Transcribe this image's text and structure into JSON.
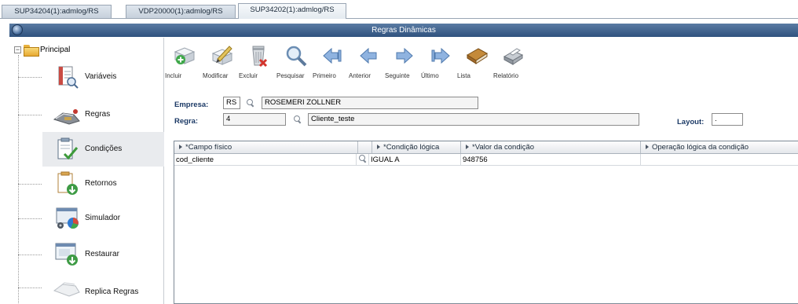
{
  "tabs": [
    {
      "label": "SUP34204(1):admlog/RS",
      "active": false
    },
    {
      "label": "VDP20000(1):admlog/RS",
      "active": false
    },
    {
      "label": "SUP34202(1):admlog/RS",
      "active": true
    }
  ],
  "window": {
    "title": "Regras Dinâmicas",
    "icon": "app-globe-icon"
  },
  "sidebar": {
    "root_label": "Principal",
    "items": [
      {
        "label": "Variáveis",
        "icon": "variables-icon"
      },
      {
        "label": "Regras",
        "icon": "rules-icon"
      },
      {
        "label": "Condições",
        "icon": "conditions-icon"
      },
      {
        "label": "Retornos",
        "icon": "returns-icon"
      },
      {
        "label": "Simulador",
        "icon": "simulator-icon"
      },
      {
        "label": "Restaurar",
        "icon": "restore-icon"
      },
      {
        "label": "Replica Regras",
        "icon": "replicate-icon"
      }
    ]
  },
  "toolbar": {
    "buttons": [
      {
        "label": "Incluir",
        "icon": "include-icon"
      },
      {
        "label": "Modificar",
        "icon": "modify-icon"
      },
      {
        "label": "Excluir",
        "icon": "delete-icon"
      },
      {
        "label": "Pesquisar",
        "icon": "search-icon"
      },
      {
        "label": "Primeiro",
        "icon": "first-icon"
      },
      {
        "label": "Anterior",
        "icon": "previous-icon"
      },
      {
        "label": "Seguinte",
        "icon": "next-icon"
      },
      {
        "label": "Último",
        "icon": "last-icon"
      },
      {
        "label": "Lista",
        "icon": "list-icon"
      },
      {
        "label": "Relatório",
        "icon": "report-icon"
      }
    ]
  },
  "form": {
    "empresa_label": "Empresa:",
    "empresa_code": "RS",
    "empresa_name": "ROSEMERI ZOLLNER",
    "regra_label": "Regra:",
    "regra_code": "4",
    "regra_name": "Cliente_teste",
    "layout_label": "Layout:",
    "layout_value": "."
  },
  "grid": {
    "columns": [
      "*Campo físico",
      "*Condição lógica",
      "*Valor da condição",
      "Operação lógica da condição"
    ],
    "rows": [
      {
        "campo": "cod_cliente",
        "condicao": "IGUAL A",
        "valor": "948756",
        "operacao": ""
      }
    ]
  },
  "colors": {
    "titlebar": "#2f527e",
    "label_blue": "#1c3a66",
    "selected_bg": "#e9ebee"
  }
}
